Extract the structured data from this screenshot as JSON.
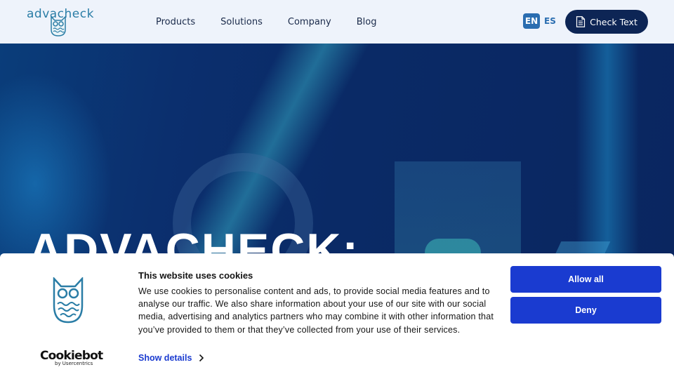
{
  "header": {
    "logo_text": "advacheck",
    "nav": [
      "Products",
      "Solutions",
      "Company",
      "Blog"
    ],
    "lang_active": "EN",
    "lang_other": "ES",
    "cta_label": "Check Text"
  },
  "hero": {
    "title": "ADVACHECK:"
  },
  "cookie_banner": {
    "title": "This website uses cookies",
    "body": "We use cookies to personalise content and ads, to provide social media features and to analyse our traffic. We also share information about your use of our site with our social media, advertising and analytics partners who may combine it with other information that you’ve provided to them or that they’ve collected from your use of their services.",
    "show_details": "Show details",
    "allow_all": "Allow all",
    "deny": "Deny",
    "brand": "Cookiebot",
    "brand_sub": "by Usercentrics"
  },
  "colors": {
    "accent": "#1a3bd0",
    "header_bg": "#eef3fb",
    "cta_bg": "#0d2555",
    "hero_bg": "#0b2a66"
  },
  "icons": [
    "owl-logo-icon",
    "document-icon",
    "chevron-right-icon"
  ]
}
